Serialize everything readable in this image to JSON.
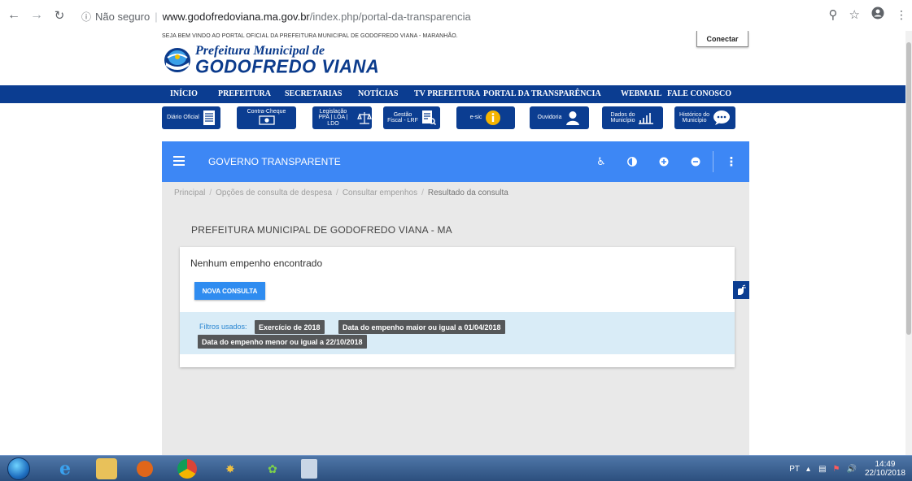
{
  "browser": {
    "security_label": "Não seguro",
    "url_host": "www.godofredoviana.ma.gov.br",
    "url_path": "/index.php/portal-da-transparencia"
  },
  "site": {
    "welcome": "SEJA BEM VINDO AO PORTAL OFICIAL DA PREFEITURA MUNICIPAL DE GODOFREDO VIANA - MARANHÃO.",
    "connect_label": "Conectar",
    "logo_line1": "Prefeitura Municipal de",
    "logo_line2": "GODOFREDO VIANA",
    "nav": [
      "INÍCIO",
      "PREFEITURA",
      "SECRETARIAS",
      "NOTÍCIAS",
      "TV PREFEITURA",
      "PORTAL DA TRANSPARÊNCIA",
      "WEBMAIL",
      "FALE CONOSCO"
    ],
    "quicklinks": [
      {
        "line1": "Diário Oficial",
        "line2": ""
      },
      {
        "line1": "Contra-Cheque",
        "line2": ""
      },
      {
        "line1": "Legislação",
        "line2": "PPA | LOA | LDO"
      },
      {
        "line1": "Gestão",
        "line2": "Fiscal - LRF"
      },
      {
        "line1": "e-sic",
        "line2": ""
      },
      {
        "line1": "Ouvidoria",
        "line2": ""
      },
      {
        "line1": "Dados do",
        "line2": "Município"
      },
      {
        "line1": "Histórico do",
        "line2": "Município"
      }
    ]
  },
  "portal": {
    "title": "GOVERNO TRANSPARENTE",
    "breadcrumb": [
      "Principal",
      "Opções de consulta de despesa",
      "Consultar empenhos",
      "Resultado da consulta"
    ],
    "org_name": "PREFEITURA MUNICIPAL DE GODOFREDO VIANA - MA",
    "result_message": "Nenhum empenho encontrado",
    "new_query_label": "NOVA CONSULTA",
    "filters_label": "Filtros usados:",
    "filters": [
      "Exercício de 2018",
      "Data do empenho maior ou igual a 01/04/2018",
      "Data do empenho menor ou igual a 22/10/2018"
    ]
  },
  "taskbar": {
    "language": "PT",
    "time": "14:49",
    "date": "22/10/2018"
  },
  "colors": {
    "nav_blue": "#0b3d91",
    "portal_blue": "#3d87f5",
    "button_blue": "#2f8cf0",
    "filter_bg": "#d9ecf7",
    "chip_bg": "#555759"
  }
}
